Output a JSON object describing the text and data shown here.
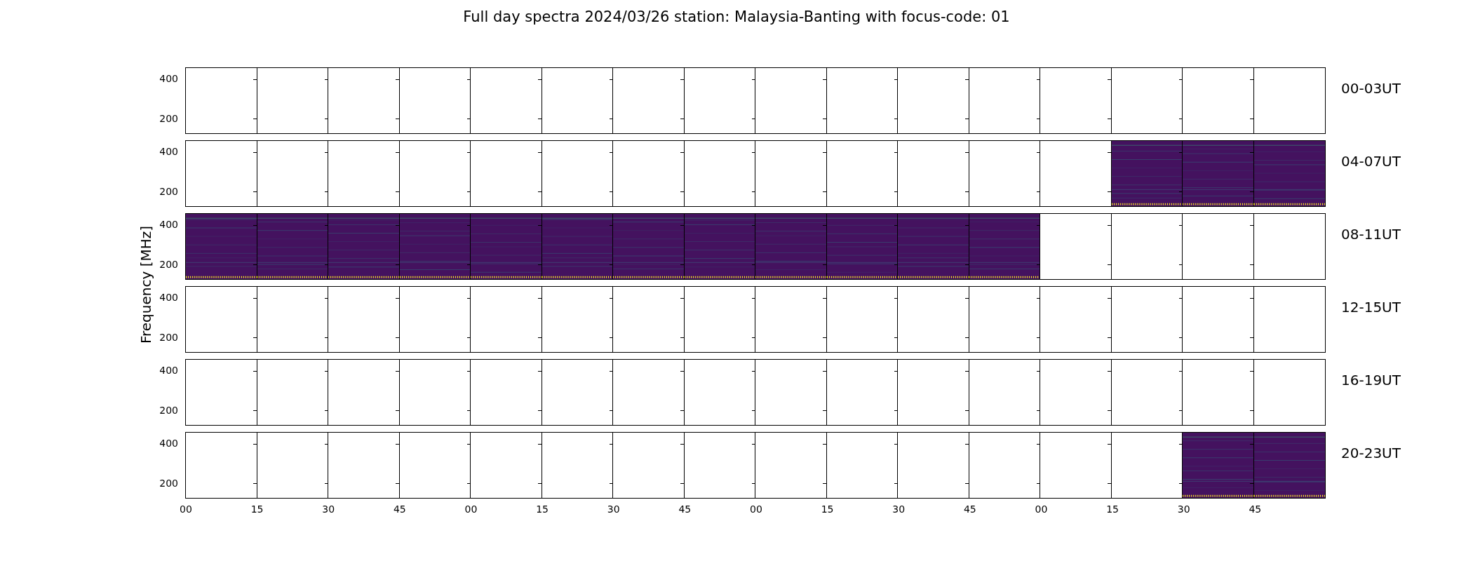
{
  "title": "Full day spectra 2024/03/26 station: Malaysia-Banting with focus-code: 01",
  "ylabel": "Frequency [MHz]",
  "rows": [
    {
      "label": "00-03UT",
      "yticks": [
        "400",
        "200"
      ],
      "panels": [
        {
          "has_data": false
        },
        {
          "has_data": false
        },
        {
          "has_data": false
        },
        {
          "has_data": false
        },
        {
          "has_data": false
        },
        {
          "has_data": false
        },
        {
          "has_data": false
        },
        {
          "has_data": false
        },
        {
          "has_data": false
        },
        {
          "has_data": false
        },
        {
          "has_data": false
        },
        {
          "has_data": false
        },
        {
          "has_data": false
        },
        {
          "has_data": false
        },
        {
          "has_data": false
        },
        {
          "has_data": false
        }
      ]
    },
    {
      "label": "04-07UT",
      "yticks": [
        "400",
        "200"
      ],
      "panels": [
        {
          "has_data": false
        },
        {
          "has_data": false
        },
        {
          "has_data": false
        },
        {
          "has_data": false
        },
        {
          "has_data": false
        },
        {
          "has_data": false
        },
        {
          "has_data": false
        },
        {
          "has_data": false
        },
        {
          "has_data": false
        },
        {
          "has_data": false
        },
        {
          "has_data": false
        },
        {
          "has_data": false
        },
        {
          "has_data": false
        },
        {
          "has_data": true
        },
        {
          "has_data": true
        },
        {
          "has_data": true
        }
      ]
    },
    {
      "label": "08-11UT",
      "yticks": [
        "400",
        "200"
      ],
      "panels": [
        {
          "has_data": true
        },
        {
          "has_data": true
        },
        {
          "has_data": true
        },
        {
          "has_data": true
        },
        {
          "has_data": true
        },
        {
          "has_data": true
        },
        {
          "has_data": true
        },
        {
          "has_data": true
        },
        {
          "has_data": true
        },
        {
          "has_data": true
        },
        {
          "has_data": true
        },
        {
          "has_data": true
        },
        {
          "has_data": false
        },
        {
          "has_data": false
        },
        {
          "has_data": false
        },
        {
          "has_data": false
        }
      ]
    },
    {
      "label": "12-15UT",
      "yticks": [
        "400",
        "200"
      ],
      "panels": [
        {
          "has_data": false
        },
        {
          "has_data": false
        },
        {
          "has_data": false
        },
        {
          "has_data": false
        },
        {
          "has_data": false
        },
        {
          "has_data": false
        },
        {
          "has_data": false
        },
        {
          "has_data": false
        },
        {
          "has_data": false
        },
        {
          "has_data": false
        },
        {
          "has_data": false
        },
        {
          "has_data": false
        },
        {
          "has_data": false
        },
        {
          "has_data": false
        },
        {
          "has_data": false
        },
        {
          "has_data": false
        }
      ]
    },
    {
      "label": "16-19UT",
      "yticks": [
        "400",
        "200"
      ],
      "panels": [
        {
          "has_data": false
        },
        {
          "has_data": false
        },
        {
          "has_data": false
        },
        {
          "has_data": false
        },
        {
          "has_data": false
        },
        {
          "has_data": false
        },
        {
          "has_data": false
        },
        {
          "has_data": false
        },
        {
          "has_data": false
        },
        {
          "has_data": false
        },
        {
          "has_data": false
        },
        {
          "has_data": false
        },
        {
          "has_data": false
        },
        {
          "has_data": false
        },
        {
          "has_data": false
        },
        {
          "has_data": false
        }
      ]
    },
    {
      "label": "20-23UT",
      "yticks": [
        "400",
        "200"
      ],
      "panels": [
        {
          "has_data": false
        },
        {
          "has_data": false
        },
        {
          "has_data": false
        },
        {
          "has_data": false
        },
        {
          "has_data": false
        },
        {
          "has_data": false
        },
        {
          "has_data": false
        },
        {
          "has_data": false
        },
        {
          "has_data": false
        },
        {
          "has_data": false
        },
        {
          "has_data": false
        },
        {
          "has_data": false
        },
        {
          "has_data": false
        },
        {
          "has_data": false
        },
        {
          "has_data": true
        },
        {
          "has_data": true
        }
      ]
    }
  ],
  "xticks": [
    "00",
    "15",
    "30",
    "45",
    "00",
    "15",
    "30",
    "45",
    "00",
    "15",
    "30",
    "45",
    "00",
    "15",
    "30",
    "45"
  ]
}
